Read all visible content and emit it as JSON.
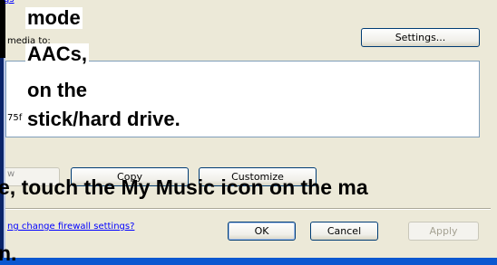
{
  "dialog": {
    "top_link": "gs",
    "copy_media_label": "media to:",
    "hex_fragment": "75f",
    "gray_fragment": "w",
    "buttons": {
      "settings": "Settings...",
      "copy": "Copy",
      "customize": "Customize",
      "ok": "OK",
      "cancel": "Cancel",
      "apply": "Apply"
    },
    "firewall_link": "ng change firewall settings?"
  },
  "caption": {
    "line1": "mode",
    "line2": "AACs,",
    "line3": "on the",
    "line4": "stick/hard drive.",
    "line5": "e, touch the My Music icon on the ma",
    "line6": "n."
  },
  "colors": {
    "dialog_bg": "#ece9d8",
    "title_blue": "#0a246a",
    "frame_blue": "#0b57d0",
    "link": "#0000ff"
  }
}
